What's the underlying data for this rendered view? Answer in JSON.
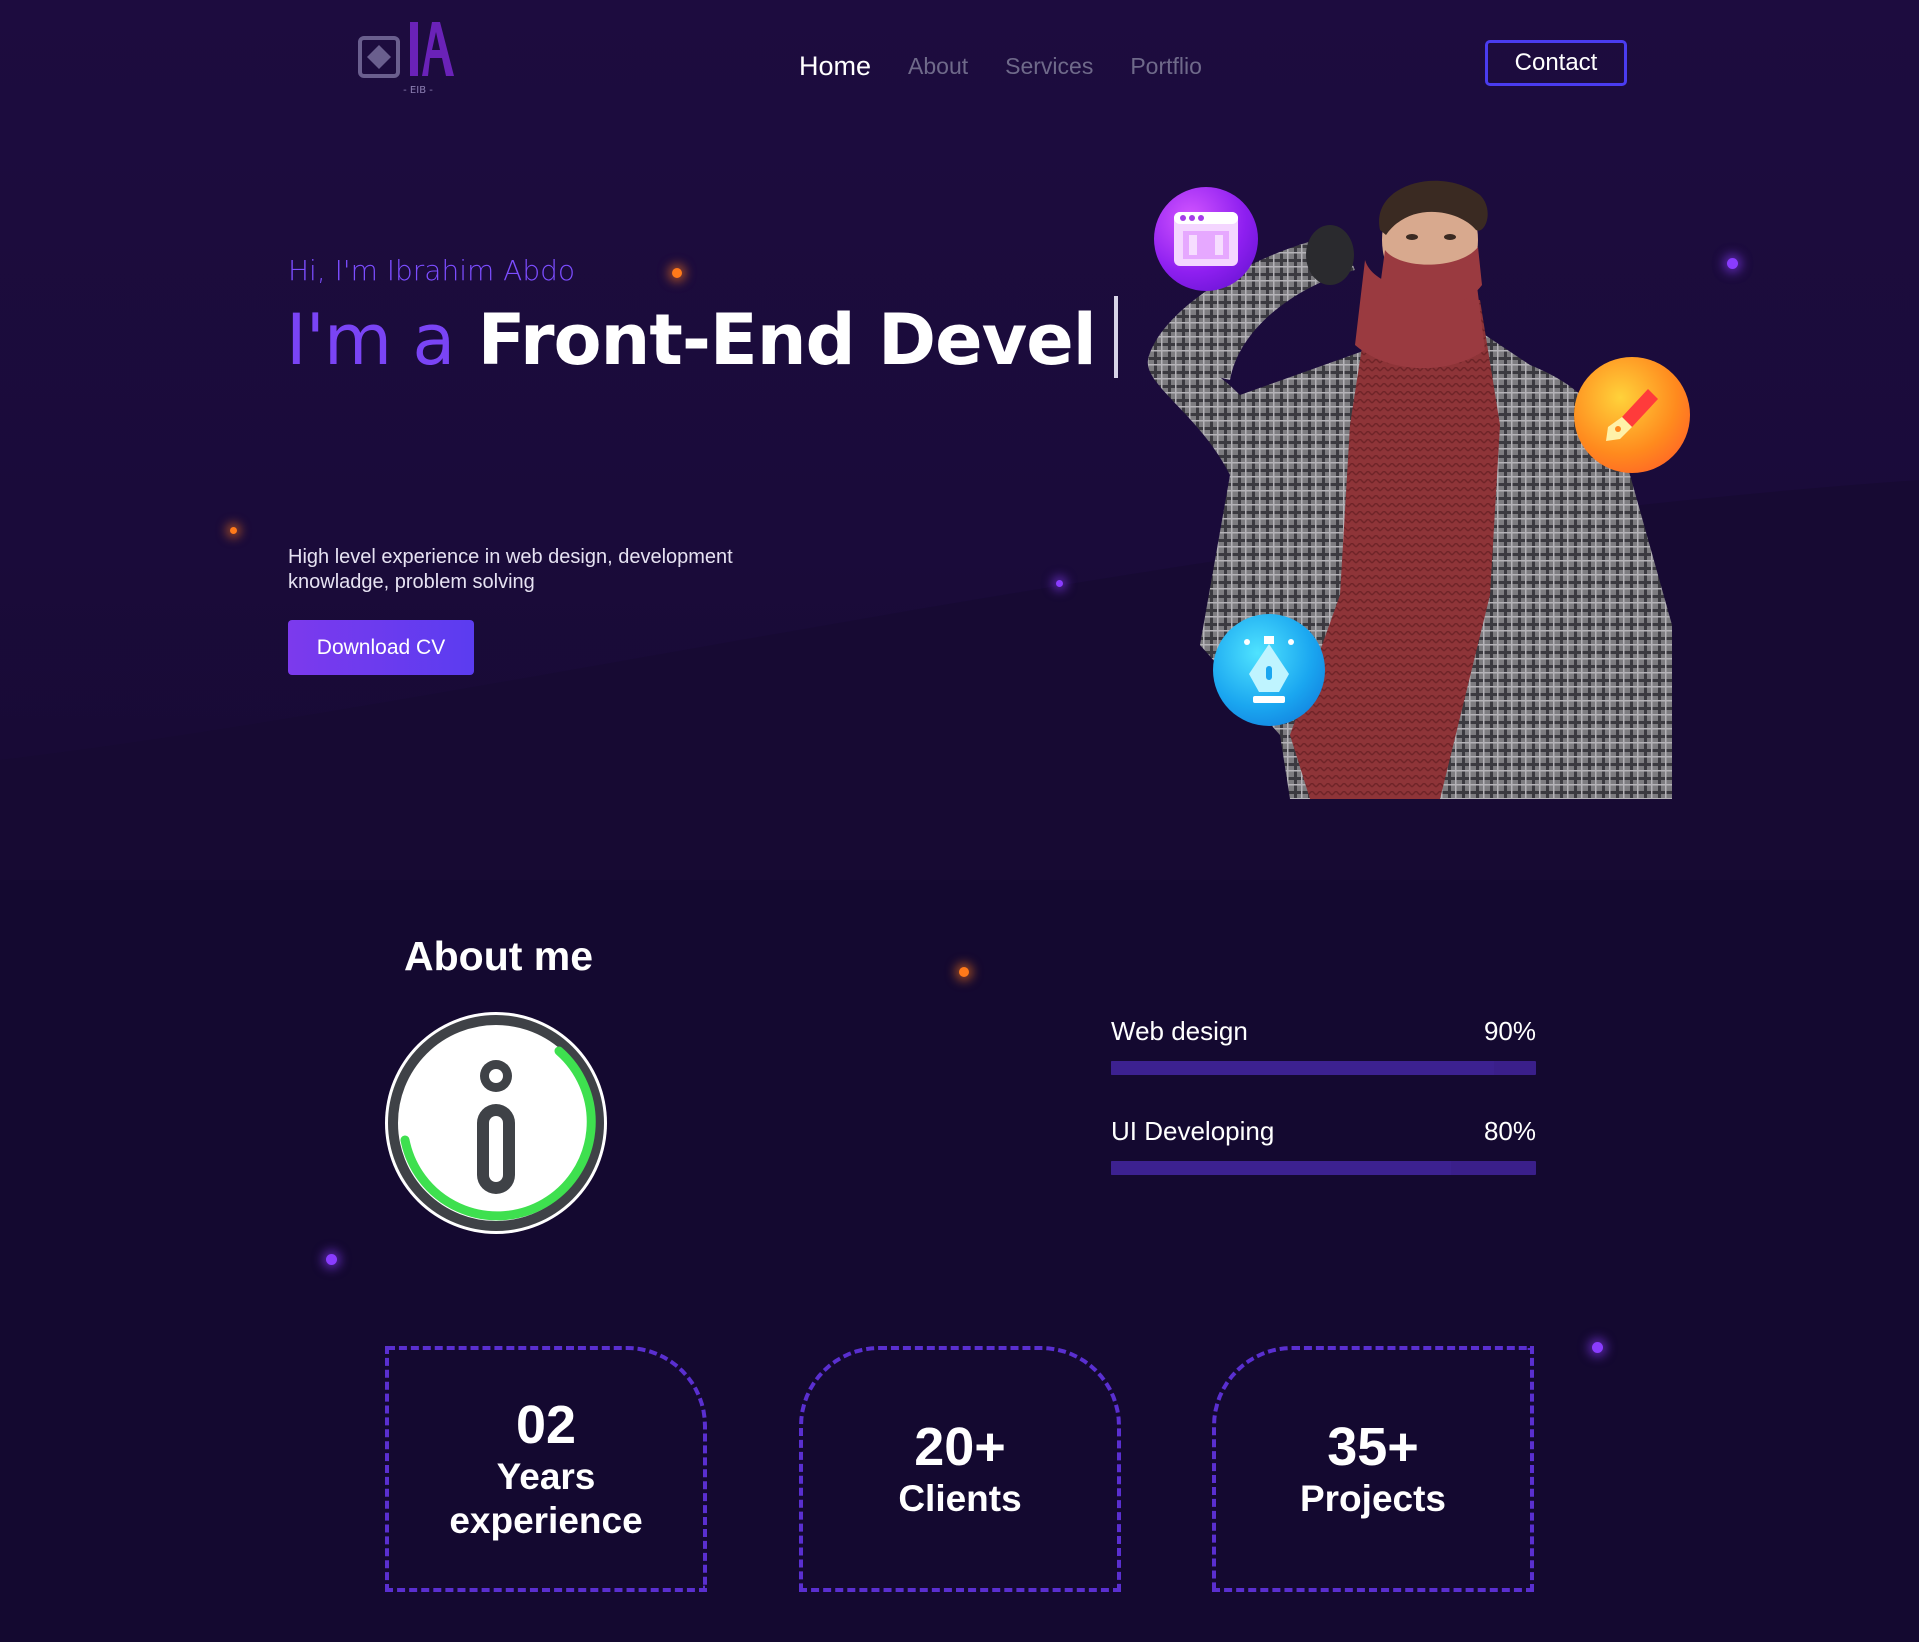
{
  "nav": {
    "logo_text": "IA",
    "logo_sub": "- EIB -",
    "items": [
      {
        "label": "Home",
        "active": true
      },
      {
        "label": "About",
        "active": false
      },
      {
        "label": "Services",
        "active": false
      },
      {
        "label": "Portflio",
        "active": false
      }
    ],
    "contact_label": "Contact"
  },
  "hero": {
    "greeting": "Hi, I'm Ibrahim Abdo",
    "headline_prefix": "I'm a",
    "headline_role": "Front-End Devel",
    "description": "High level experience in web design, development knowladge, problem solving",
    "download_label": "Download CV",
    "bubble_icons": [
      "browser-window-icon",
      "pen-brush-icon",
      "vector-pen-icon"
    ]
  },
  "about": {
    "title": "About me",
    "icon": "info-icon",
    "skills": [
      {
        "name": "Web design",
        "percent_label": "90%",
        "percent": 90
      },
      {
        "name": "UI Developing",
        "percent_label": "80%",
        "percent": 80
      }
    ]
  },
  "stats": [
    {
      "number": "02",
      "label": "Years experience"
    },
    {
      "number": "20+",
      "label": "Clients"
    },
    {
      "number": "35+",
      "label": "Projects"
    }
  ],
  "colors": {
    "accent": "#7c4dff",
    "button": "#7c3aed",
    "contact_border": "#4a3cf0",
    "stat_border": "#5a2fd0",
    "background": "#150a2e"
  }
}
